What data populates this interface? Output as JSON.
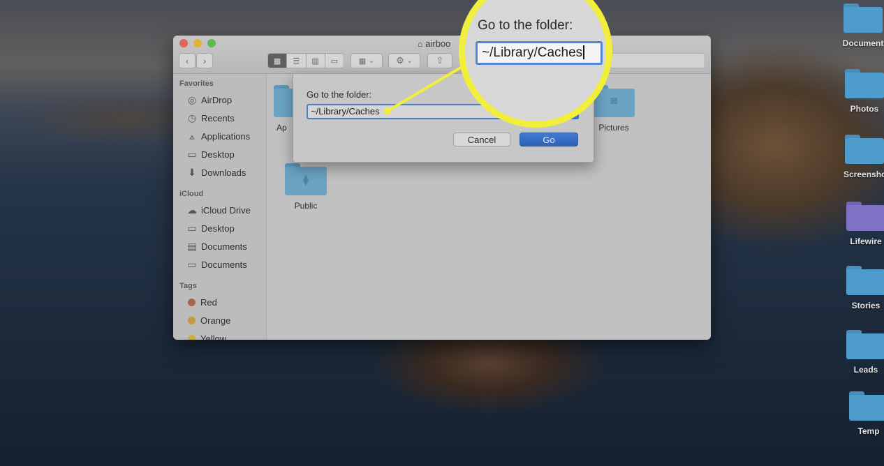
{
  "window": {
    "title": "airboo",
    "traffic_lights": {
      "close": "#e0655a",
      "minimize": "#e2b13c",
      "maximize": "#5cbd4d"
    },
    "toolbar": {
      "back_icon": "chevron-left-icon",
      "forward_icon": "chevron-right-icon",
      "view_modes": [
        "icon-view",
        "list-view",
        "column-view",
        "gallery-view"
      ],
      "active_view": "icon-view",
      "group_icon": "group-icon",
      "action_icon": "gear-icon",
      "share_icon": "share-icon",
      "chevron": "⌄"
    }
  },
  "sidebar": {
    "sections": [
      {
        "heading": "Favorites",
        "items": [
          {
            "label": "AirDrop",
            "icon": "airdrop-icon",
            "glyph": "◎"
          },
          {
            "label": "Recents",
            "icon": "clock-icon",
            "glyph": "◷"
          },
          {
            "label": "Applications",
            "icon": "applications-icon",
            "glyph": "⟑"
          },
          {
            "label": "Desktop",
            "icon": "desktop-icon",
            "glyph": "▭"
          },
          {
            "label": "Downloads",
            "icon": "download-icon",
            "glyph": "⬇"
          }
        ]
      },
      {
        "heading": "iCloud",
        "items": [
          {
            "label": "iCloud Drive",
            "icon": "cloud-icon",
            "glyph": "☁"
          },
          {
            "label": "Desktop",
            "icon": "desktop-icon",
            "glyph": "▭"
          },
          {
            "label": "Documents",
            "icon": "document-icon",
            "glyph": "▤"
          },
          {
            "label": "Documents",
            "icon": "folder-icon",
            "glyph": "▭"
          }
        ]
      },
      {
        "heading": "Tags",
        "items": [
          {
            "label": "Red",
            "color": "#a8654d"
          },
          {
            "label": "Orange",
            "color": "#c49a44"
          },
          {
            "label": "Yellow",
            "color": "#c9ad43"
          }
        ]
      }
    ]
  },
  "content": {
    "folders": [
      {
        "label": "Ap",
        "icon": "applications-folder-icon",
        "glyph": ""
      },
      {
        "label": "Pictures",
        "icon": "pictures-folder-icon",
        "glyph": "◙"
      },
      {
        "label": "Public",
        "icon": "public-folder-icon",
        "glyph": "⧫"
      }
    ]
  },
  "dialog": {
    "label": "Go to the folder:",
    "value": "~/Library/Caches",
    "dropdown_icon": "chevron-down-icon",
    "cancel": "Cancel",
    "go": "Go"
  },
  "magnifier": {
    "label": "Go to the folder:",
    "value": "~/Library/Caches",
    "highlight_color": "#f2ef3c"
  },
  "desktop": {
    "items": [
      {
        "label": "Document",
        "color": "#4e9ccc"
      },
      {
        "label": "Photos",
        "color": "#4e9ccc"
      },
      {
        "label": "Screensho",
        "color": "#4e9ccc"
      },
      {
        "label": "Lifewire",
        "color": "#7f72c4"
      },
      {
        "label": "Stories",
        "color": "#4e9ccc"
      },
      {
        "label": "Leads",
        "color": "#4e9ccc"
      },
      {
        "label": "Temp",
        "color": "#4e9ccc"
      }
    ]
  }
}
